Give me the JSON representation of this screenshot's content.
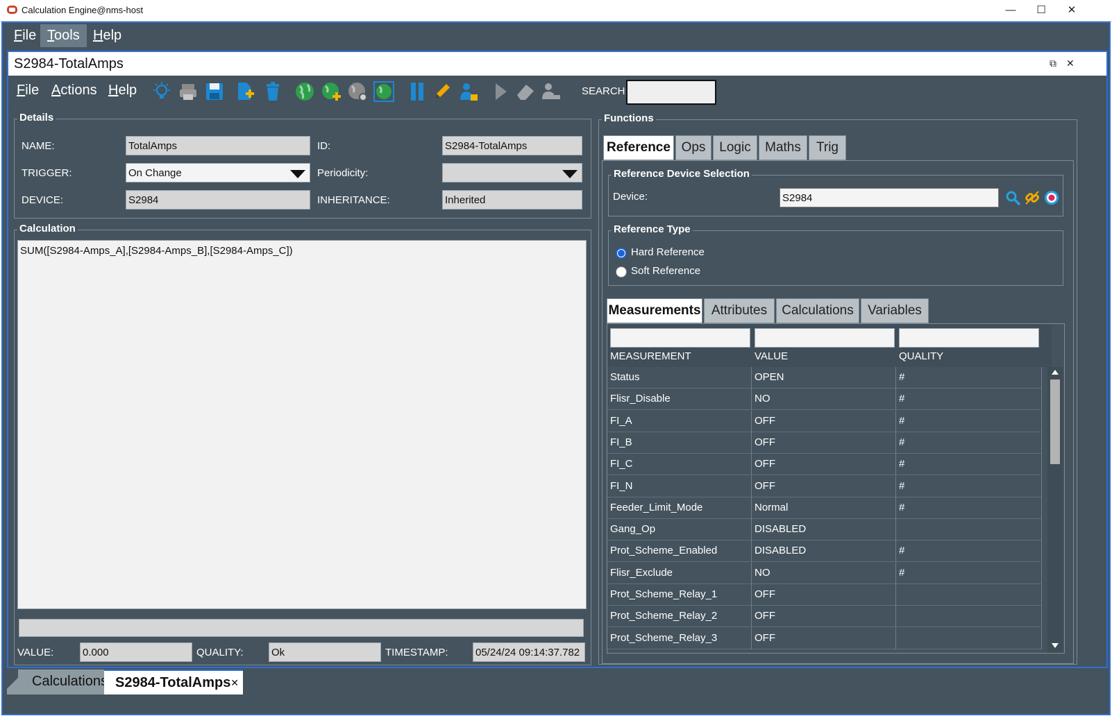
{
  "os": {
    "title": "Calculation Engine@nms-host",
    "min": "—",
    "max": "☐",
    "close": "✕"
  },
  "menubar": [
    {
      "label": "File",
      "u": "F",
      "rest": "ile"
    },
    {
      "label": "Tools",
      "u": "T",
      "rest": "ools"
    },
    {
      "label": "Help",
      "u": "H",
      "rest": "elp"
    }
  ],
  "window": {
    "title": "S2984-TotalAmps",
    "restore": "⧉",
    "close": "✕"
  },
  "toolbar": {
    "menus": [
      {
        "u": "F",
        "rest": "ile"
      },
      {
        "u": "A",
        "rest": "ctions"
      },
      {
        "u": "H",
        "rest": "elp"
      }
    ],
    "search_label": "SEARCH:",
    "search_value": ""
  },
  "details": {
    "title": "Details",
    "name_label": "NAME:",
    "name_value": "TotalAmps",
    "id_label": "ID:",
    "id_value": "S2984-TotalAmps",
    "trigger_label": "TRIGGER:",
    "trigger_value": "On Change",
    "periodicity_label": "Periodicity:",
    "periodicity_value": "",
    "device_label": "DEVICE:",
    "device_value": "S2984",
    "inheritance_label": "INHERITANCE:",
    "inheritance_value": "Inherited"
  },
  "calculation": {
    "title": "Calculation",
    "expression": "SUM([S2984-Amps_A],[S2984-Amps_B],[S2984-Amps_C])",
    "status_line": "",
    "value_label": "VALUE:",
    "value": "0.000",
    "quality_label": "QUALITY:",
    "quality": "Ok",
    "timestamp_label": "TIMESTAMP:",
    "timestamp": "05/24/24 09:14:37.782"
  },
  "functions": {
    "title": "Functions",
    "tabs": [
      "Reference",
      "Ops",
      "Logic",
      "Maths",
      "Trig"
    ],
    "ref_device_title": "Reference Device Selection",
    "device_label": "Device:",
    "device_value": "S2984",
    "ref_type_title": "Reference Type",
    "hard_ref": "Hard Reference",
    "soft_ref": "Soft Reference",
    "subtabs": [
      "Measurements",
      "Attributes",
      "Calculations",
      "Variables"
    ],
    "columns": [
      "MEASUREMENT",
      "VALUE",
      "QUALITY"
    ],
    "rows": [
      [
        "Status",
        "OPEN",
        "#"
      ],
      [
        "Flisr_Disable",
        "NO",
        "#"
      ],
      [
        "FI_A",
        "OFF",
        "#"
      ],
      [
        "FI_B",
        "OFF",
        "#"
      ],
      [
        "FI_C",
        "OFF",
        "#"
      ],
      [
        "FI_N",
        "OFF",
        "#"
      ],
      [
        "Feeder_Limit_Mode",
        "Normal",
        "#"
      ],
      [
        "Gang_Op",
        "DISABLED",
        ""
      ],
      [
        "Prot_Scheme_Enabled",
        "DISABLED",
        "#"
      ],
      [
        "Flisr_Exclude",
        "NO",
        "#"
      ],
      [
        "Prot_Scheme_Relay_1",
        "OFF",
        ""
      ],
      [
        "Prot_Scheme_Relay_2",
        "OFF",
        ""
      ],
      [
        "Prot_Scheme_Relay_3",
        "OFF",
        ""
      ]
    ]
  },
  "bottom_tabs": [
    "Calculations",
    "S2984-TotalAmps"
  ],
  "bottom_tab_close": "✕",
  "colors": {
    "accent": "#2f6fd6",
    "panel": "#44535d",
    "icon_blue": "#1e88d0",
    "icon_green": "#2e9e4a"
  }
}
